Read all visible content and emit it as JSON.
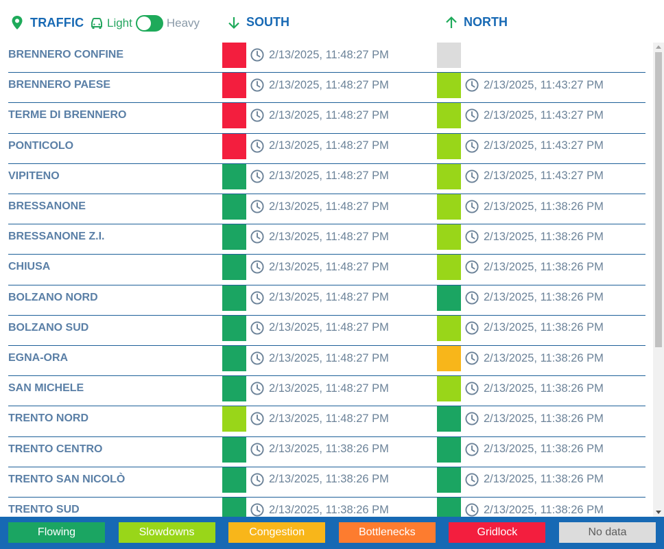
{
  "header": {
    "traffic_label": "TRAFFIC",
    "light_label": "Light",
    "heavy_label": "Heavy",
    "south_label": "SOUTH",
    "north_label": "NORTH",
    "icons": {
      "traffic": "location-pin-icon",
      "toggle": "car-icon",
      "south": "arrow-down-icon",
      "north": "arrow-up-icon",
      "time": "clock-icon"
    }
  },
  "colors": {
    "flowing": "#1ba562",
    "slowdowns": "#99d619",
    "congestion": "#f8b61a",
    "bottlenecks": "#fd7c2f",
    "gridlock": "#f31e3e",
    "nodata": "#dcdcdc",
    "accent": "#1769b4"
  },
  "rows": [
    {
      "name": "BRENNERO CONFINE",
      "south": {
        "status": "gridlock",
        "time": "2/13/2025, 11:48:27 PM"
      },
      "north": {
        "status": "nodata",
        "time": ""
      }
    },
    {
      "name": "BRENNERO PAESE",
      "south": {
        "status": "gridlock",
        "time": "2/13/2025, 11:48:27 PM"
      },
      "north": {
        "status": "slowdowns",
        "time": "2/13/2025, 11:43:27 PM"
      }
    },
    {
      "name": "TERME DI BRENNERO",
      "south": {
        "status": "gridlock",
        "time": "2/13/2025, 11:48:27 PM"
      },
      "north": {
        "status": "slowdowns",
        "time": "2/13/2025, 11:43:27 PM"
      }
    },
    {
      "name": "PONTICOLO",
      "south": {
        "status": "gridlock",
        "time": "2/13/2025, 11:48:27 PM"
      },
      "north": {
        "status": "slowdowns",
        "time": "2/13/2025, 11:43:27 PM"
      }
    },
    {
      "name": "VIPITENO",
      "south": {
        "status": "flowing",
        "time": "2/13/2025, 11:48:27 PM"
      },
      "north": {
        "status": "slowdowns",
        "time": "2/13/2025, 11:43:27 PM"
      }
    },
    {
      "name": "BRESSANONE",
      "south": {
        "status": "flowing",
        "time": "2/13/2025, 11:48:27 PM"
      },
      "north": {
        "status": "slowdowns",
        "time": "2/13/2025, 11:38:26 PM"
      }
    },
    {
      "name": "BRESSANONE Z.I.",
      "south": {
        "status": "flowing",
        "time": "2/13/2025, 11:48:27 PM"
      },
      "north": {
        "status": "slowdowns",
        "time": "2/13/2025, 11:38:26 PM"
      }
    },
    {
      "name": "CHIUSA",
      "south": {
        "status": "flowing",
        "time": "2/13/2025, 11:48:27 PM"
      },
      "north": {
        "status": "slowdowns",
        "time": "2/13/2025, 11:38:26 PM"
      }
    },
    {
      "name": "BOLZANO NORD",
      "south": {
        "status": "flowing",
        "time": "2/13/2025, 11:48:27 PM"
      },
      "north": {
        "status": "flowing",
        "time": "2/13/2025, 11:38:26 PM"
      }
    },
    {
      "name": "BOLZANO SUD",
      "south": {
        "status": "flowing",
        "time": "2/13/2025, 11:48:27 PM"
      },
      "north": {
        "status": "slowdowns",
        "time": "2/13/2025, 11:38:26 PM"
      }
    },
    {
      "name": "EGNA-ORA",
      "south": {
        "status": "flowing",
        "time": "2/13/2025, 11:48:27 PM"
      },
      "north": {
        "status": "congestion",
        "time": "2/13/2025, 11:38:26 PM"
      }
    },
    {
      "name": "SAN MICHELE",
      "south": {
        "status": "flowing",
        "time": "2/13/2025, 11:48:27 PM"
      },
      "north": {
        "status": "slowdowns",
        "time": "2/13/2025, 11:38:26 PM"
      }
    },
    {
      "name": "TRENTO NORD",
      "south": {
        "status": "slowdowns",
        "time": "2/13/2025, 11:48:27 PM"
      },
      "north": {
        "status": "flowing",
        "time": "2/13/2025, 11:38:26 PM"
      }
    },
    {
      "name": "TRENTO CENTRO",
      "south": {
        "status": "flowing",
        "time": "2/13/2025, 11:38:26 PM"
      },
      "north": {
        "status": "flowing",
        "time": "2/13/2025, 11:38:26 PM"
      }
    },
    {
      "name": "TRENTO SAN NICOLÒ",
      "south": {
        "status": "flowing",
        "time": "2/13/2025, 11:38:26 PM"
      },
      "north": {
        "status": "flowing",
        "time": "2/13/2025, 11:38:26 PM"
      }
    },
    {
      "name": "TRENTO SUD",
      "south": {
        "status": "flowing",
        "time": "2/13/2025, 11:38:26 PM"
      },
      "north": {
        "status": "flowing",
        "time": "2/13/2025, 11:38:26 PM"
      }
    }
  ],
  "legend": [
    {
      "key": "flowing",
      "label": "Flowing"
    },
    {
      "key": "slowdowns",
      "label": "Slowdowns"
    },
    {
      "key": "congestion",
      "label": "Congestion"
    },
    {
      "key": "bottlenecks",
      "label": "Bottlenecks"
    },
    {
      "key": "gridlock",
      "label": "Gridlock"
    },
    {
      "key": "nodata",
      "label": "No data"
    }
  ]
}
